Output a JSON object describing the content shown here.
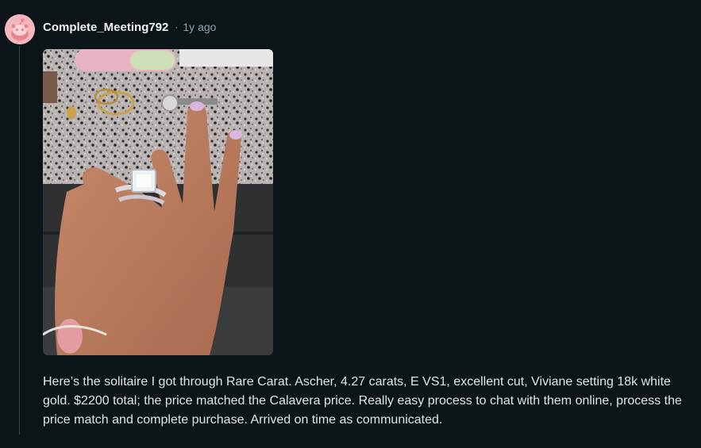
{
  "comment": {
    "author": "Complete_Meeting792",
    "separator": "·",
    "timestamp": "1y ago",
    "avatar_icon": "snoo-avatar-icon",
    "body": "Here’s the solitaire I got through Rare Carat. Ascher, 4.27 carats, E VS1, excellent cut, Viviane setting 18k white gold. $2200 total; the price matched the Calavera price. Really easy process to chat with them online, process the price match and complete purchase. Arrived on time as communicated."
  },
  "colors": {
    "background": "#0b1416",
    "avatar": "#f5b5bd",
    "author_text": "#f2f4f5",
    "meta_text": "#8ba2ad",
    "body_text": "#dfe6e9",
    "thread_line": "#3a4447"
  }
}
